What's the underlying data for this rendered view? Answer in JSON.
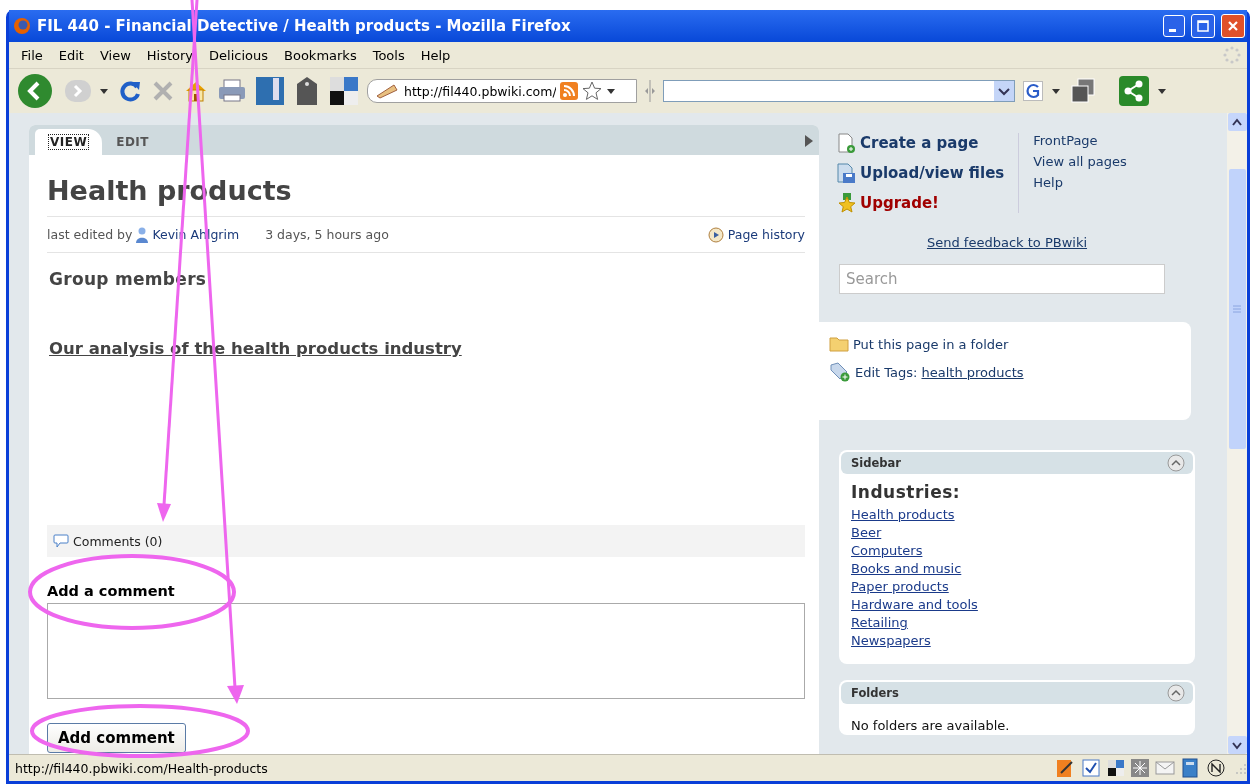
{
  "window": {
    "title": "FIL 440 - Financial Detective / Health products - Mozilla Firefox"
  },
  "menu": [
    "File",
    "Edit",
    "View",
    "History",
    "Delicious",
    "Bookmarks",
    "Tools",
    "Help"
  ],
  "address_bar": {
    "value": "http://fil440.pbwiki.com/"
  },
  "tabs": [
    {
      "label": "VIEW",
      "selected": true
    },
    {
      "label": "EDIT",
      "selected": false
    }
  ],
  "page": {
    "title": "Health products",
    "edited_prefix": "last edited by",
    "author": "Kevin Ahlgrim",
    "edited_time": "3 days, 5 hours ago",
    "history_link": "Page history",
    "heading": "Group members",
    "analysis_link": "Our analysis of the health products industry"
  },
  "comments": {
    "header": "Comments (0)",
    "add_label": "Add a comment",
    "button": "Add comment"
  },
  "actions": [
    {
      "kind": "create",
      "label": "Create a page"
    },
    {
      "kind": "upload",
      "label": "Upload/view files"
    },
    {
      "kind": "upgrade",
      "label": "Upgrade!"
    }
  ],
  "nav_links": [
    "FrontPage",
    "View all pages",
    "Help"
  ],
  "feedback_link": "Send feedback to PBwiki",
  "search": {
    "placeholder": "Search"
  },
  "page_tools": {
    "folder_link": "Put this page in a folder",
    "tags_label": "Edit Tags:",
    "tag": "health products"
  },
  "sidebar": {
    "title": "Sidebar",
    "heading": "Industries:",
    "links": [
      "Health products",
      "Beer",
      "Computers",
      "Books and music",
      "Paper products",
      "Hardware and tools",
      "Retailing",
      "Newspapers"
    ]
  },
  "folders": {
    "title": "Folders",
    "empty_text": "No folders are available."
  },
  "status_bar": {
    "url": "http://fil440.pbwiki.com/Health-products"
  }
}
